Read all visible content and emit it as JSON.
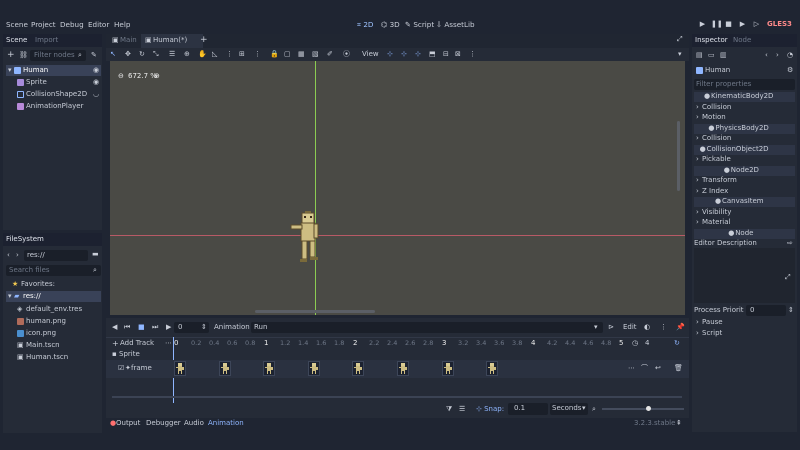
{
  "menu": [
    "Scene",
    "Project",
    "Debug",
    "Editor",
    "Help"
  ],
  "workspaces": [
    "2D",
    "3D",
    "Script",
    "AssetLib"
  ],
  "renderer": "GLES3",
  "scene_dock": {
    "tabs": [
      "Scene",
      "Import"
    ],
    "filter_placeholder": "Filter nodes",
    "nodes": [
      "Human",
      "Sprite",
      "CollisionShape2D",
      "AnimationPlayer"
    ]
  },
  "filesystem": {
    "title": "FileSystem",
    "path": "res://",
    "search_placeholder": "Search files",
    "favorites": "Favorites:",
    "root": "res://",
    "files": [
      "default_env.tres",
      "human.png",
      "icon.png",
      "Main.tscn",
      "Human.tscn"
    ]
  },
  "editor_tabs": [
    "Main",
    "Human(*)"
  ],
  "toolbar": {
    "view": "View"
  },
  "zoom": "672.7 %",
  "inspector": {
    "tabs": [
      "Inspector",
      "Node"
    ],
    "node": "Human",
    "filter_placeholder": "Filter properties",
    "rows": [
      {
        "kind": "class",
        "label": "KinematicBody2D"
      },
      {
        "kind": "section",
        "label": "Collision"
      },
      {
        "kind": "section",
        "label": "Motion"
      },
      {
        "kind": "class",
        "label": "PhysicsBody2D"
      },
      {
        "kind": "section",
        "label": "Collision"
      },
      {
        "kind": "class",
        "label": "CollisionObject2D"
      },
      {
        "kind": "section",
        "label": "Pickable"
      },
      {
        "kind": "class",
        "label": "Node2D"
      },
      {
        "kind": "section",
        "label": "Transform"
      },
      {
        "kind": "section",
        "label": "Z Index"
      },
      {
        "kind": "class",
        "label": "CanvasItem"
      },
      {
        "kind": "section",
        "label": "Visibility"
      },
      {
        "kind": "section",
        "label": "Material"
      },
      {
        "kind": "class",
        "label": "Node"
      },
      {
        "kind": "plain",
        "label": "Editor Description"
      }
    ],
    "process_priority_label": "Process Priorit",
    "process_priority_value": "0",
    "pause": "Pause",
    "script": "Script"
  },
  "animation": {
    "time": "0",
    "label": "Animation",
    "name": "Run",
    "edit": "Edit",
    "add_track": "Add Track",
    "ticks": [
      "0",
      "0.2",
      "0.4",
      "0.6",
      "0.8",
      "1",
      "1.2",
      "1.4",
      "1.6",
      "1.8",
      "2",
      "2.2",
      "2.4",
      "2.6",
      "2.8",
      "3",
      "3.2",
      "3.4",
      "3.6",
      "3.8",
      "4",
      "4.2",
      "4.4",
      "4.6",
      "4.8",
      "5"
    ],
    "length": "4",
    "track_group": "Sprite",
    "track_name": "frame",
    "keyframe_count": 8,
    "snap_label": "Snap:",
    "snap_value": "0.1",
    "snap_unit": "Seconds"
  },
  "bottom_tabs": [
    "Output",
    "Debugger",
    "Audio",
    "Animation"
  ],
  "version": "3.2.3.stable"
}
